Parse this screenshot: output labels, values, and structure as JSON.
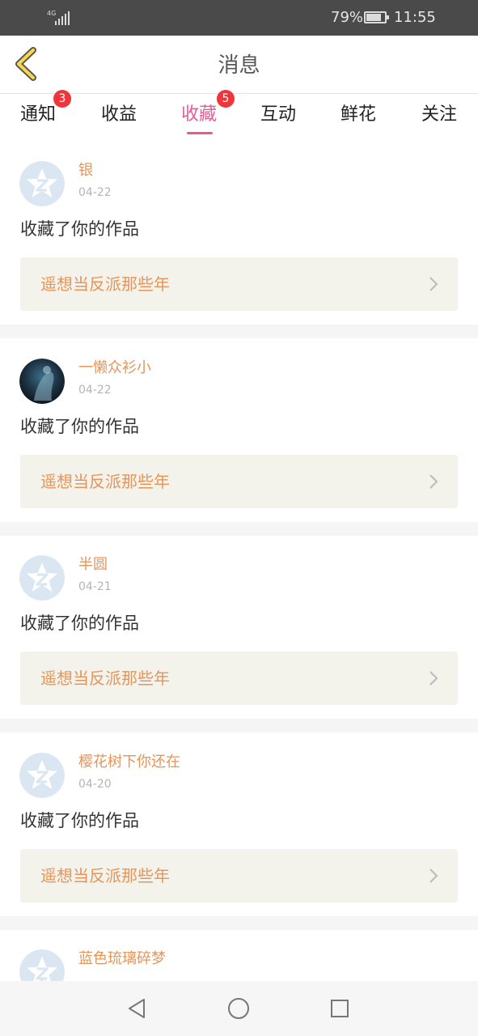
{
  "status_bar": {
    "network": "4G",
    "battery_percent": "79%",
    "time": "11:55"
  },
  "header": {
    "title": "消息",
    "back_icon": "chevron-left-icon"
  },
  "tabs": [
    {
      "label": "通知",
      "badge": "3",
      "active": false
    },
    {
      "label": "收益",
      "badge": "",
      "active": false
    },
    {
      "label": "收藏",
      "badge": "5",
      "active": true
    },
    {
      "label": "互动",
      "badge": "",
      "active": false
    },
    {
      "label": "鲜花",
      "badge": "",
      "active": false
    },
    {
      "label": "关注",
      "badge": "",
      "active": false
    }
  ],
  "colors": {
    "accent_pink": "#e45c9a",
    "name_orange": "#e6955a",
    "badge_red": "#f0343c"
  },
  "items": [
    {
      "user": "银",
      "date": "04-22",
      "action": "收藏了你的作品",
      "work_title": "遥想当反派那些年",
      "avatar": "default-avatar-icon"
    },
    {
      "user": "一懒众衫小",
      "date": "04-22",
      "action": "收藏了你的作品",
      "work_title": "遥想当反派那些年",
      "avatar": "photo-avatar"
    },
    {
      "user": "半圆",
      "date": "04-21",
      "action": "收藏了你的作品",
      "work_title": "遥想当反派那些年",
      "avatar": "default-avatar-icon"
    },
    {
      "user": "樱花树下你还在",
      "date": "04-20",
      "action": "收藏了你的作品",
      "work_title": "遥想当反派那些年",
      "avatar": "default-avatar-icon"
    },
    {
      "user": "蓝色琉璃碎梦",
      "date": "",
      "action": "",
      "work_title": "",
      "avatar": "default-avatar-icon"
    }
  ],
  "nav_bar": {
    "back": "triangle-back-icon",
    "home": "circle-home-icon",
    "recents": "square-recents-icon"
  }
}
